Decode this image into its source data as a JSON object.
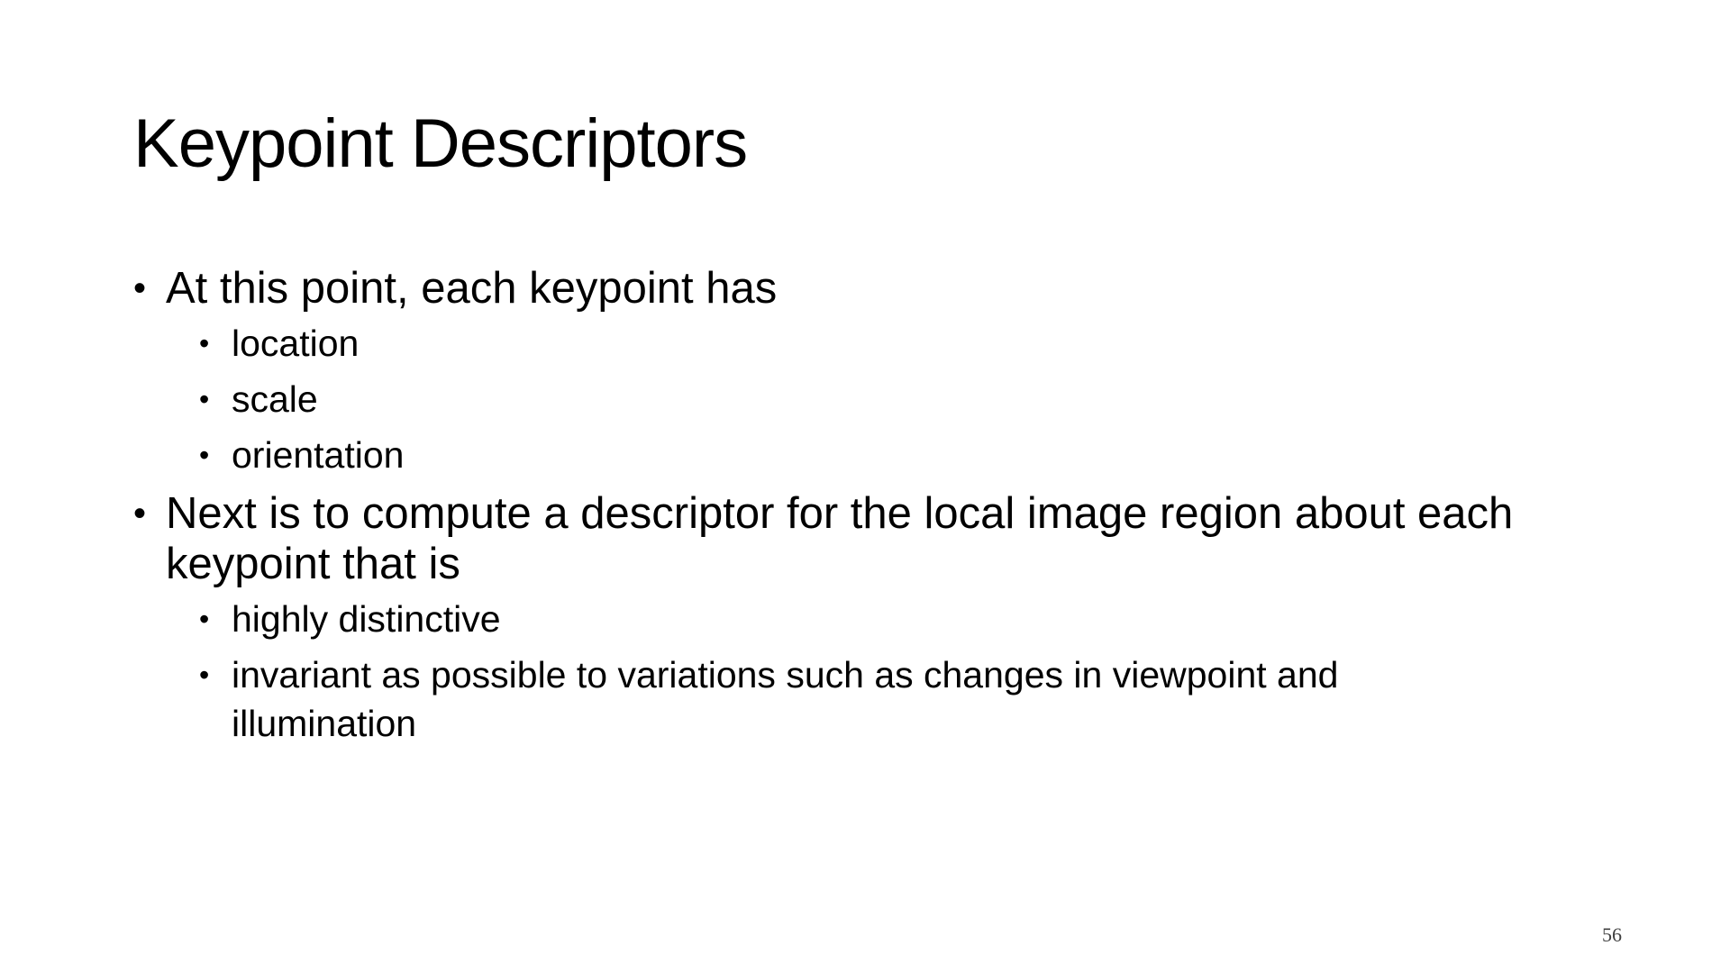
{
  "slide": {
    "title": "Keypoint Descriptors",
    "bullet_glyph": "•",
    "items": [
      {
        "text": "At this point, each keypoint has",
        "subitems": [
          "location",
          "scale",
          "orientation"
        ]
      },
      {
        "text": "Next is to compute a descriptor for the local image region about each keypoint that is",
        "subitems": [
          "highly distinctive",
          "invariant as possible to variations such as changes in viewpoint and illumination"
        ]
      }
    ],
    "page_number": "56"
  }
}
